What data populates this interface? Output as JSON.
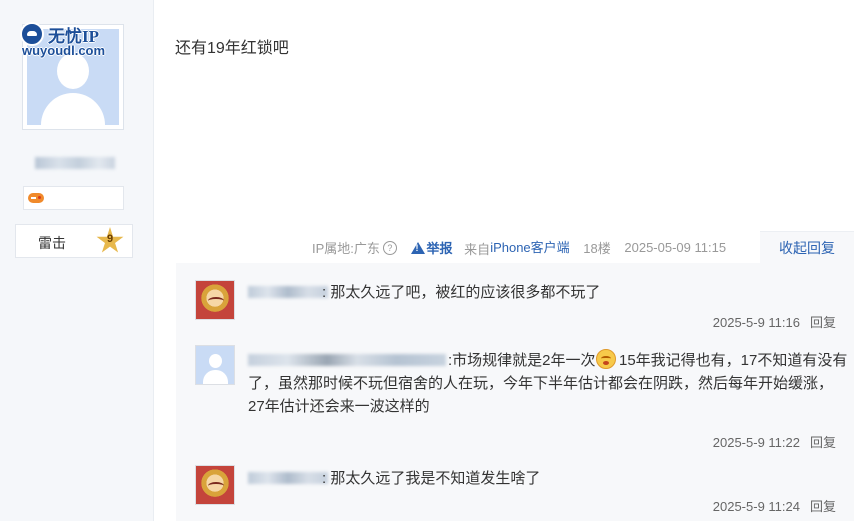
{
  "watermark": {
    "title": "无忧IP",
    "url": "wuyoudl.com"
  },
  "user": {
    "level_name": "雷击",
    "level_number": "9"
  },
  "post": {
    "content": "还有19年红锁吧",
    "ip_label": "IP属地:广东",
    "report": "举报",
    "from_prefix": "来自",
    "client": "iPhone客户端",
    "floor": "18楼",
    "time": "2025-05-09 11:15",
    "toggle_reply": "收起回复"
  },
  "replies": [
    {
      "text": ": 那太久远了吧，被红的应该很多都不玩了",
      "time": "2025-5-9 11:16",
      "reply_label": "回复"
    },
    {
      "text_part1": ":市场规律就是2年一次",
      "text_part2": "15年我记得也有，17不知道有没有了，虽然那时候不玩但宿舍的人在玩，今年下半年估计都会在阴跌，然后每年开始缓涨，27年估计还会来一波这样的",
      "time": "2025-5-9 11:22",
      "reply_label": "回复"
    },
    {
      "text": ": 那太久远了我是不知道发生啥了",
      "time": "2025-5-9 11:24",
      "reply_label": "回复"
    }
  ]
}
